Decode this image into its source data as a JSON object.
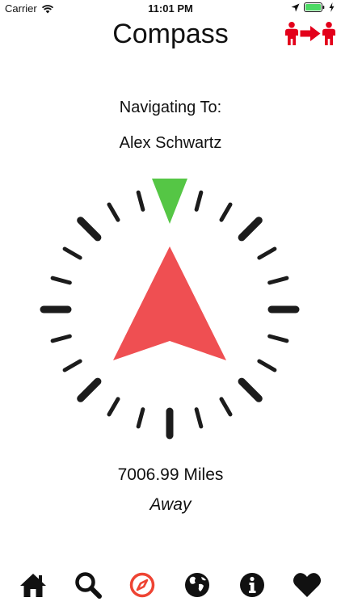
{
  "status_bar": {
    "carrier": "Carrier",
    "time": "11:01 PM",
    "icons": [
      "wifi-icon",
      "location-arrow-icon",
      "battery-icon",
      "charging-bolt-icon"
    ],
    "battery_color": "#4cd964"
  },
  "header": {
    "title": "Compass",
    "share_icon": "person-to-person-icon",
    "accent": "#e3001b"
  },
  "navigation": {
    "label": "Navigating To:",
    "destination": "Alex Schwartz"
  },
  "compass": {
    "pointer_color": "#ef4f52",
    "north_marker_color": "#55c645",
    "tick_color": "#1c1c1c"
  },
  "distance": {
    "value": "7006.99 Miles",
    "suffix": "Away"
  },
  "tab_bar": {
    "active_color": "#ee4433",
    "items": [
      {
        "icon": "home-icon",
        "active": false
      },
      {
        "icon": "search-icon",
        "active": false
      },
      {
        "icon": "compass-icon",
        "active": true
      },
      {
        "icon": "globe-icon",
        "active": false
      },
      {
        "icon": "info-icon",
        "active": false
      },
      {
        "icon": "heart-icon",
        "active": false
      }
    ]
  }
}
